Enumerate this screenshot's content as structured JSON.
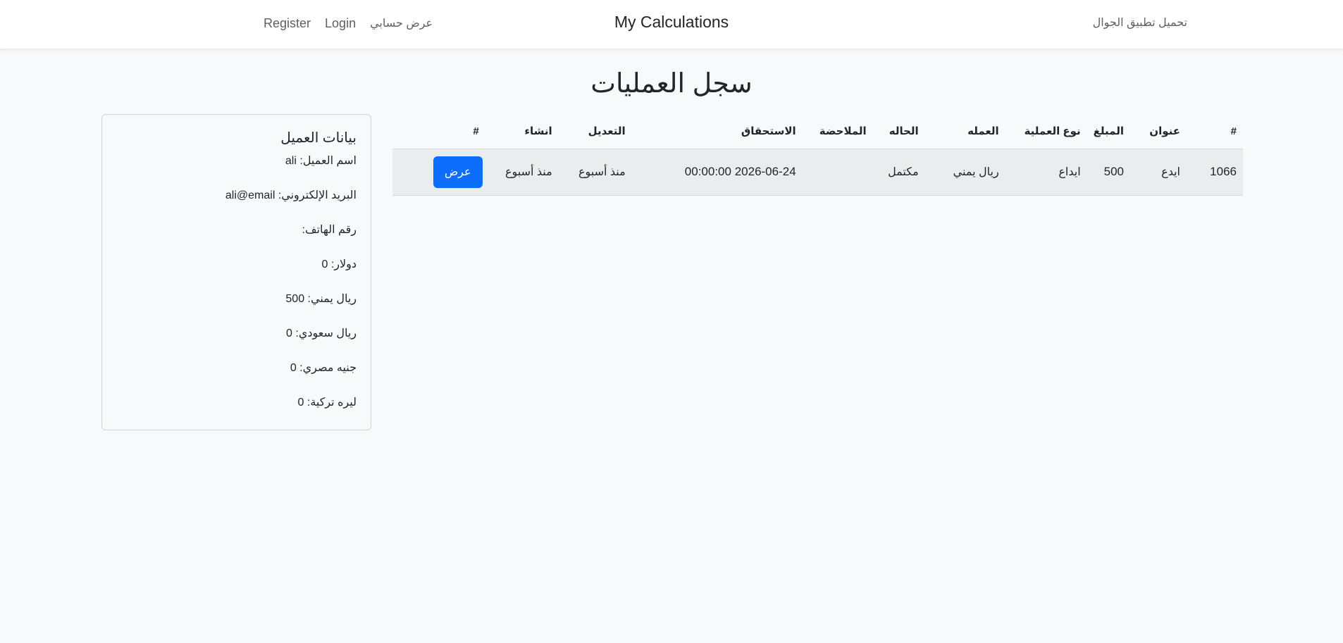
{
  "navbar": {
    "brand": "My Calculations",
    "register": "Register",
    "login": "Login",
    "my_account": "عرض حسابي",
    "download_app": "تحميل تطبيق الجوال"
  },
  "page": {
    "title": "سجل العمليات"
  },
  "customer": {
    "title": "بيانات العميل",
    "rows": [
      "اسم العميل: ali",
      "البريد الإلكتروني: ali@email",
      "رقم الهاتف:",
      "دولار: 0",
      "ريال يمني: 500",
      "ريال سعودي: 0",
      "جنيه مصري: 0",
      "ليره تركية: 0"
    ]
  },
  "table": {
    "headers": [
      "#",
      "عنوان",
      "المبلغ",
      "نوع العملية",
      "العمله",
      "الحاله",
      "الملاحضة",
      "الاستحقاق",
      "التعديل",
      "انشاء",
      "#"
    ],
    "rows": [
      {
        "id": "1066",
        "title": "ايدع",
        "amount": "500",
        "type": "ايداع",
        "currency": "ريال يمني",
        "status": "مكتمل",
        "note": "",
        "due": "2026-06-24 00:00:00",
        "modified": "منذ أسبوع",
        "created": "منذ أسبوع",
        "action": "عرض"
      }
    ]
  },
  "colors": {
    "primary": "#0d6efd",
    "background": "#f8f9fa",
    "row_bg": "#ebecee"
  }
}
